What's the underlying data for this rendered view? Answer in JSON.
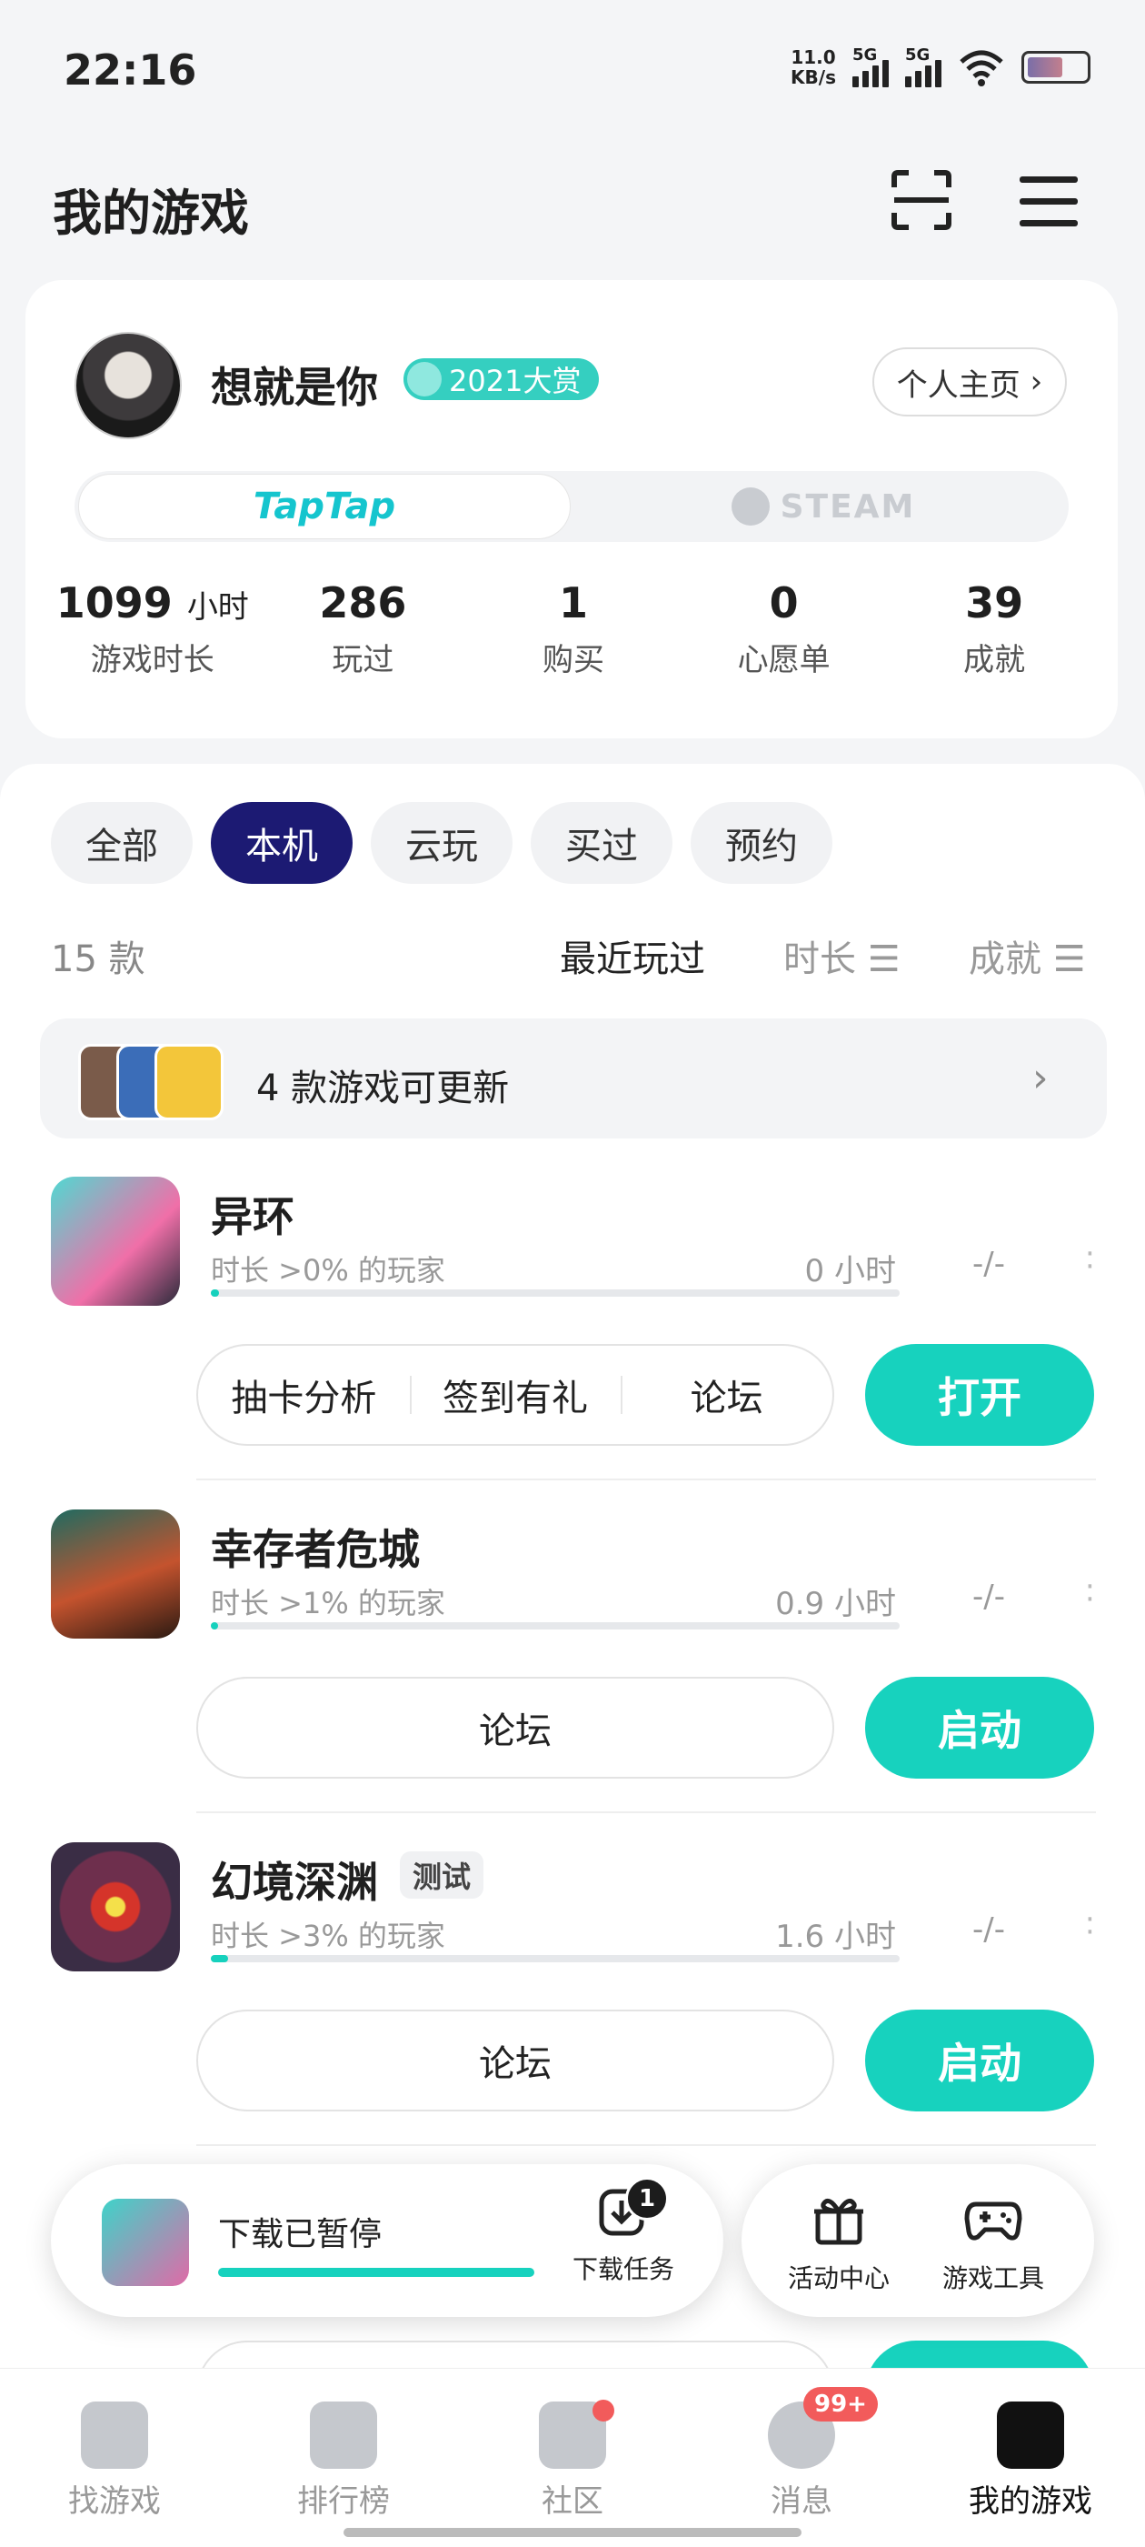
{
  "status": {
    "time": "22:16",
    "net_speed": "11.0",
    "net_unit": "KB/s",
    "sig1": "5G",
    "sig2": "5G"
  },
  "header": {
    "title": "我的游戏"
  },
  "profile": {
    "username": "想就是你",
    "badge": "2021大赏",
    "home_button": "个人主页",
    "platforms": {
      "active": "TapTap",
      "other": "STEAM"
    },
    "stats": [
      {
        "value": "1099",
        "unit": "小时",
        "label": "游戏时长"
      },
      {
        "value": "286",
        "unit": "",
        "label": "玩过"
      },
      {
        "value": "1",
        "unit": "",
        "label": "购买"
      },
      {
        "value": "0",
        "unit": "",
        "label": "心愿单"
      },
      {
        "value": "39",
        "unit": "",
        "label": "成就"
      }
    ]
  },
  "filters": {
    "chips": [
      "全部",
      "本机",
      "云玩",
      "买过",
      "预约"
    ],
    "active": "本机"
  },
  "sort": {
    "count": "15 款",
    "options": [
      "最近玩过",
      "时长 ☰",
      "成就 ☰"
    ]
  },
  "update_bar": {
    "text": "4 款游戏可更新"
  },
  "games": [
    {
      "title": "异环",
      "sub": "时长 >0% 的玩家",
      "hours": "0 小时",
      "ach": "-/-",
      "progress": 0.01,
      "actions": [
        "抽卡分析",
        "签到有礼",
        "论坛"
      ],
      "button": "打开",
      "tag": ""
    },
    {
      "title": "幸存者危城",
      "sub": "时长 >1% 的玩家",
      "hours": "0.9 小时",
      "ach": "-/-",
      "progress": 0.01,
      "actions": [
        "论坛"
      ],
      "button": "启动",
      "tag": ""
    },
    {
      "title": "幻境深渊",
      "sub": "时长 >3% 的玩家",
      "hours": "1.6 小时",
      "ach": "-/-",
      "progress": 0.02,
      "actions": [
        "论坛"
      ],
      "button": "启动",
      "tag": "测试"
    }
  ],
  "download": {
    "status": "下载已暂停",
    "task_label": "下载任务",
    "task_count": "1",
    "progress": 0.72
  },
  "tools": [
    {
      "label": "活动中心",
      "icon": "gift-icon"
    },
    {
      "label": "游戏工具",
      "icon": "gamepad-icon"
    }
  ],
  "nav": [
    {
      "label": "找游戏",
      "icon": "discover-icon"
    },
    {
      "label": "排行榜",
      "icon": "ranking-icon"
    },
    {
      "label": "社区",
      "icon": "community-icon"
    },
    {
      "label": "消息",
      "icon": "message-icon",
      "badge": "99+"
    },
    {
      "label": "我的游戏",
      "icon": "my-games-icon",
      "active": true
    }
  ],
  "colors": {
    "accent": "#17d2be",
    "chip_active": "#1c1a73",
    "taptap": "#15c5ce"
  }
}
